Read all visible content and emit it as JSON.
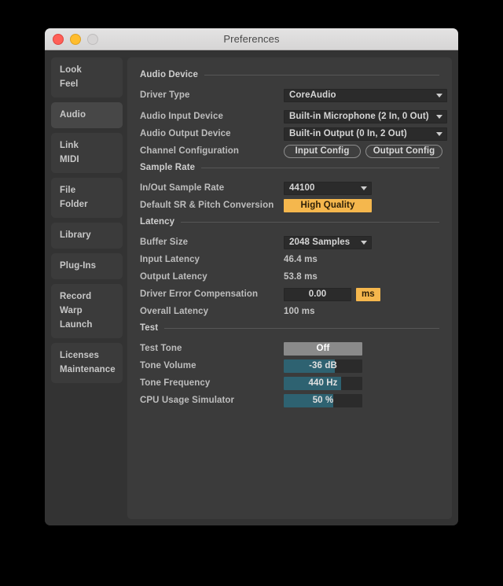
{
  "window": {
    "title": "Preferences",
    "traffic_lights": [
      "close-button",
      "minimize-button",
      "zoom-button"
    ]
  },
  "sidebar": {
    "groups": [
      {
        "selected": false,
        "items": [
          "Look",
          "Feel"
        ]
      },
      {
        "selected": true,
        "items": [
          "Audio"
        ]
      },
      {
        "selected": false,
        "items": [
          "Link",
          "MIDI"
        ]
      },
      {
        "selected": false,
        "items": [
          "File",
          "Folder"
        ]
      },
      {
        "selected": false,
        "items": [
          "Library"
        ]
      },
      {
        "selected": false,
        "items": [
          "Plug-Ins"
        ]
      },
      {
        "selected": false,
        "items": [
          "Record",
          "Warp",
          "Launch"
        ]
      },
      {
        "selected": false,
        "items": [
          "Licenses",
          "Maintenance"
        ]
      }
    ]
  },
  "sections": {
    "audio_device": {
      "title": "Audio Device",
      "driver_type": {
        "label": "Driver Type",
        "value": "CoreAudio"
      },
      "input_device": {
        "label": "Audio Input Device",
        "value": "Built-in Microphone (2 In, 0 Out)"
      },
      "output_device": {
        "label": "Audio Output Device",
        "value": "Built-in Output (0 In, 2 Out)"
      },
      "channel_config": {
        "label": "Channel Configuration",
        "input_button": "Input Config",
        "output_button": "Output Config"
      }
    },
    "sample_rate": {
      "title": "Sample Rate",
      "inout_rate": {
        "label": "In/Out Sample Rate",
        "value": "44100"
      },
      "sr_pitch": {
        "label": "Default SR & Pitch Conversion",
        "value": "High Quality"
      }
    },
    "latency": {
      "title": "Latency",
      "buffer_size": {
        "label": "Buffer Size",
        "value": "2048 Samples"
      },
      "input_latency": {
        "label": "Input Latency",
        "value": "46.4 ms"
      },
      "output_latency": {
        "label": "Output Latency",
        "value": "53.8 ms"
      },
      "driver_error": {
        "label": "Driver Error Compensation",
        "value": "0.00",
        "unit": "ms"
      },
      "overall_latency": {
        "label": "Overall Latency",
        "value": "100 ms"
      }
    },
    "test": {
      "title": "Test",
      "test_tone": {
        "label": "Test Tone",
        "value": "Off"
      },
      "tone_volume": {
        "label": "Tone Volume",
        "value": "-36 dB",
        "fill_percent": 65
      },
      "tone_frequency": {
        "label": "Tone Frequency",
        "value": "440 Hz",
        "fill_percent": 73
      },
      "cpu_usage": {
        "label": "CPU Usage Simulator",
        "value": "50 %",
        "fill_percent": 63
      }
    }
  },
  "colors": {
    "accent_orange": "#f5b74d",
    "slider_teal": "#2e6271",
    "panel_bg": "#3b3b3b",
    "window_bg": "#333333"
  }
}
